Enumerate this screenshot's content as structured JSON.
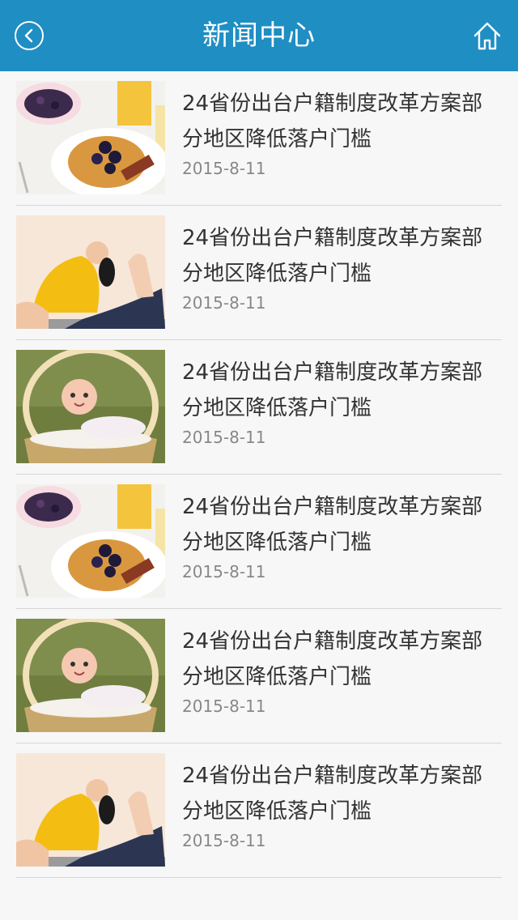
{
  "header": {
    "title": "新闻中心",
    "back_icon": "chevron-left-circle-icon",
    "home_icon": "home-icon"
  },
  "colors": {
    "header_bg": "#1f8ec3",
    "background": "#f7f7f7",
    "headline": "#333333",
    "date": "#888888"
  },
  "news": [
    {
      "thumb": "breakfast",
      "headline": "24省份出台户籍制度改革方案部分地区降低落户门槛",
      "date": "2015-8-11"
    },
    {
      "thumb": "yoga",
      "headline": "24省份出台户籍制度改革方案部分地区降低落户门槛",
      "date": "2015-8-11"
    },
    {
      "thumb": "baby",
      "headline": "24省份出台户籍制度改革方案部分地区降低落户门槛",
      "date": "2015-8-11"
    },
    {
      "thumb": "breakfast",
      "headline": "24省份出台户籍制度改革方案部分地区降低落户门槛",
      "date": "2015-8-11"
    },
    {
      "thumb": "baby",
      "headline": "24省份出台户籍制度改革方案部分地区降低落户门槛",
      "date": "2015-8-11"
    },
    {
      "thumb": "yoga",
      "headline": "24省份出台户籍制度改革方案部分地区降低落户门槛",
      "date": "2015-8-11"
    }
  ]
}
